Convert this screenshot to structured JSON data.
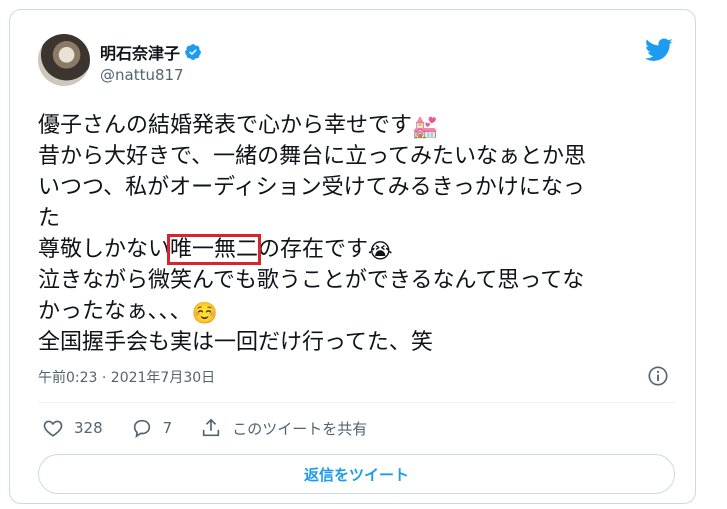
{
  "author": {
    "name": "明石奈津子",
    "handle": "@nattu817"
  },
  "tweet": {
    "line1": "優子さんの結婚発表で心から幸せです",
    "line1_emoji": "💒",
    "line2": "昔から大好きで、一緒の舞台に立ってみたいなぁとか思",
    "line3": "いつつ、私がオーディション受けてみるきっかけになっ",
    "line4": "た",
    "line5_pre": "尊敬しかない",
    "line5_highlight": "唯一無二",
    "line5_post": "の存在です",
    "line5_emoji": "😭",
    "line6": "泣きながら微笑んでも歌うことができるなんて思ってな",
    "line7": "かったなぁ、、、",
    "line7_emoji": "☺️",
    "line8": "全国握手会も実は一回だけ行ってた、笑"
  },
  "timestamp": "午前0:23 · 2021年7月30日",
  "actions": {
    "likes": "328",
    "replies": "7",
    "share_label": "このツイートを共有"
  },
  "reply_button_label": "返信をツイート",
  "colors": {
    "accent": "#1d9bf0",
    "highlight_box": "#d6252c",
    "text": "#0f1419",
    "secondary": "#536471"
  }
}
